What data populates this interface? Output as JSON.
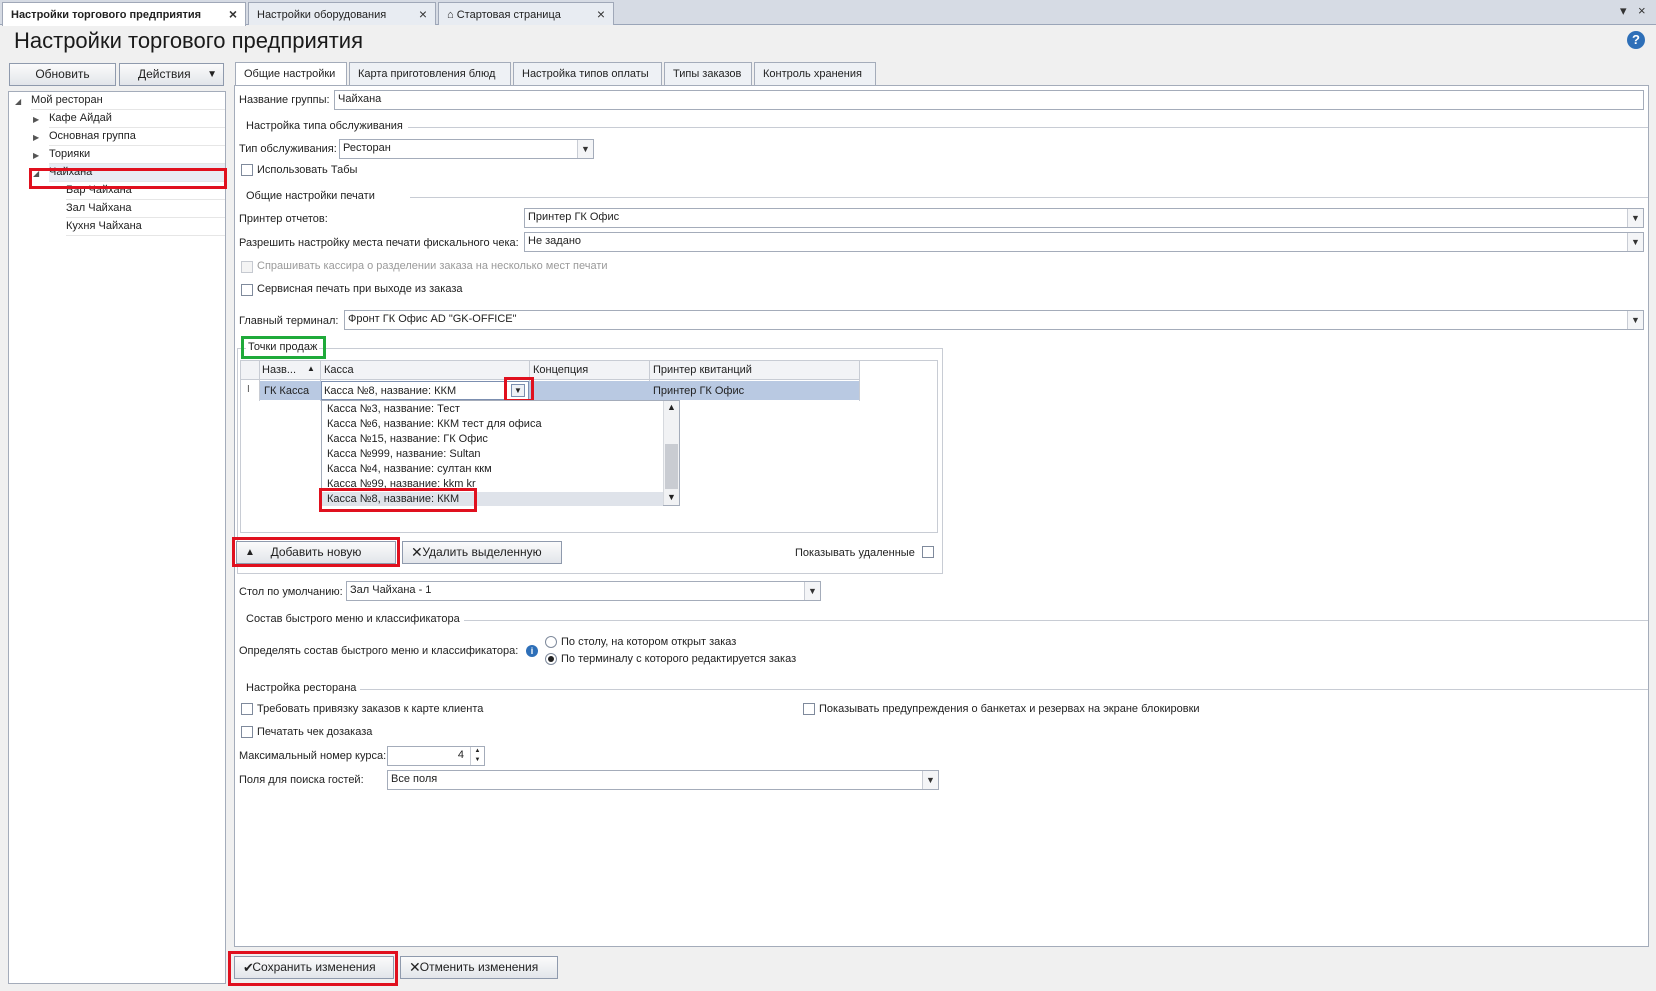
{
  "doc_tabs": [
    {
      "label": "Настройки торгового предприятия"
    },
    {
      "label": "Настройки оборудования"
    },
    {
      "label": "Стартовая страница"
    }
  ],
  "page_title": "Настройки торгового предприятия",
  "toolbar": {
    "refresh_label": "Обновить",
    "actions_label": "Действия"
  },
  "tree": {
    "root": "Мой ресторан",
    "items": [
      "Кафе Айдай",
      "Основная группа",
      "Торияки",
      "Чайхана"
    ],
    "children": [
      "Бар Чайхана",
      "Зал Чайхана",
      "Кухня Чайхана"
    ]
  },
  "tabs": [
    "Общие настройки",
    "Карта приготовления блюд",
    "Настройка типов оплаты",
    "Типы заказов",
    "Контроль хранения"
  ],
  "group_name": {
    "label": "Название группы:",
    "value": "Чайхана"
  },
  "service": {
    "section": "Настройка типа обслуживания",
    "type_label": "Тип обслуживания:",
    "type_value": "Ресторан",
    "use_tabs_label": "Использовать Табы"
  },
  "print": {
    "section": "Общие настройки печати",
    "report_printer_label": "Принтер отчетов:",
    "report_printer_value": "Принтер ГК Офис",
    "fiscal_label": "Разрешить настройку места печати фискального чека:",
    "fiscal_value": "Не задано",
    "ask_cashier_label": "Спрашивать кассира о разделении заказа на несколько мест печати",
    "service_print_label": "Сервисная печать при выходе из заказа"
  },
  "main_terminal": {
    "label": "Главный терминал:",
    "value": "Фронт ГК Офис AD \"GK-OFFICE\""
  },
  "sales_points": {
    "section": "Точки продаж",
    "columns": [
      "Назв...",
      "Касса",
      "Концепция",
      "Принтер квитанций"
    ],
    "row": {
      "name": "ГК Касса",
      "cash": "Касса №8, название: ККМ",
      "concept": "",
      "printer": "Принтер ГК Офис"
    },
    "dropdown_options": [
      "Касса №3, название: Тест",
      "Касса №6, название: ККМ тест для офиса",
      "Касса №15, название: ГК Офис",
      "Касса №999, название: Sultan",
      "Касса №4, название: султан ккм",
      "Касса №99, название: kkm kr",
      "Касса №8, название: ККМ"
    ],
    "add_label": "Добавить новую",
    "delete_label": "Удалить выделенную",
    "show_deleted_label": "Показывать удаленные"
  },
  "default_table": {
    "label": "Стол по умолчанию:",
    "value": "Зал Чайхана - 1"
  },
  "quick_menu": {
    "section": "Состав быстрого меню и классификатора",
    "label": "Определять состав быстрого меню и классификатора:",
    "option1": "По столу, на котором открыт заказ",
    "option2": "По терминалу с которого редактируется заказ"
  },
  "restaurant": {
    "section": "Настройка ресторана",
    "require_card_label": "Требовать привязку заказов к карте клиента",
    "show_warnings_label": "Показывать предупреждения о банкетах и резервах на экране блокировки",
    "print_check_label": "Печатать чек дозаказа",
    "max_course_label": "Максимальный номер курса:",
    "max_course_value": "4",
    "guest_search_label": "Поля для поиска гостей:",
    "guest_search_value": "Все поля"
  },
  "footer": {
    "save_label": "Сохранить изменения",
    "cancel_label": "Отменить изменения"
  }
}
